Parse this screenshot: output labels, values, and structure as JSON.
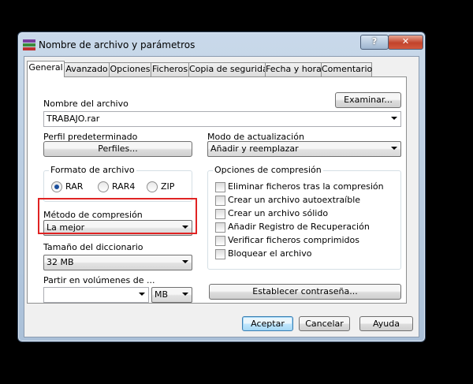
{
  "window": {
    "title": "Nombre de archivo y parámetros",
    "help_label": "?",
    "close_label": "✕"
  },
  "tabs": [
    {
      "label": "General"
    },
    {
      "label": "Avanzado"
    },
    {
      "label": "Opciones"
    },
    {
      "label": "Ficheros"
    },
    {
      "label": "Copia de seguridad"
    },
    {
      "label": "Fecha y hora"
    },
    {
      "label": "Comentario"
    }
  ],
  "general": {
    "filename_label": "Nombre del archivo",
    "filename_value": "TRABAJO.rar",
    "browse_label": "Examinar...",
    "profile_label": "Perfil predeterminado",
    "profiles_button": "Perfiles...",
    "update_mode_label": "Modo de actualización",
    "update_mode_value": "Añadir y reemplazar",
    "format_label": "Formato de archivo",
    "formats": [
      {
        "label": "RAR",
        "selected": true
      },
      {
        "label": "RAR4",
        "selected": false
      },
      {
        "label": "ZIP",
        "selected": false
      }
    ],
    "method_label": "Método de compresión",
    "method_value": "La mejor",
    "dict_label": "Tamaño del diccionario",
    "dict_value": "32 MB",
    "split_label": "Partir en volúmenes de ...",
    "split_value": "",
    "split_unit": "MB",
    "options_label": "Opciones de compresión",
    "options": [
      {
        "label": "Eliminar ficheros tras la compresión",
        "checked": false
      },
      {
        "label": "Crear un archivo autoextraíble",
        "checked": false
      },
      {
        "label": "Crear un archivo sólido",
        "checked": false
      },
      {
        "label": "Añadir Registro de Recuperación",
        "checked": false
      },
      {
        "label": "Verificar ficheros comprimidos",
        "checked": false
      },
      {
        "label": "Bloquear el archivo",
        "checked": false
      }
    ],
    "password_button": "Establecer contraseña..."
  },
  "footer": {
    "ok": "Aceptar",
    "cancel": "Cancelar",
    "help": "Ayuda"
  },
  "colors": {
    "highlight": "#e02323",
    "accent": "#1c4f9c"
  }
}
